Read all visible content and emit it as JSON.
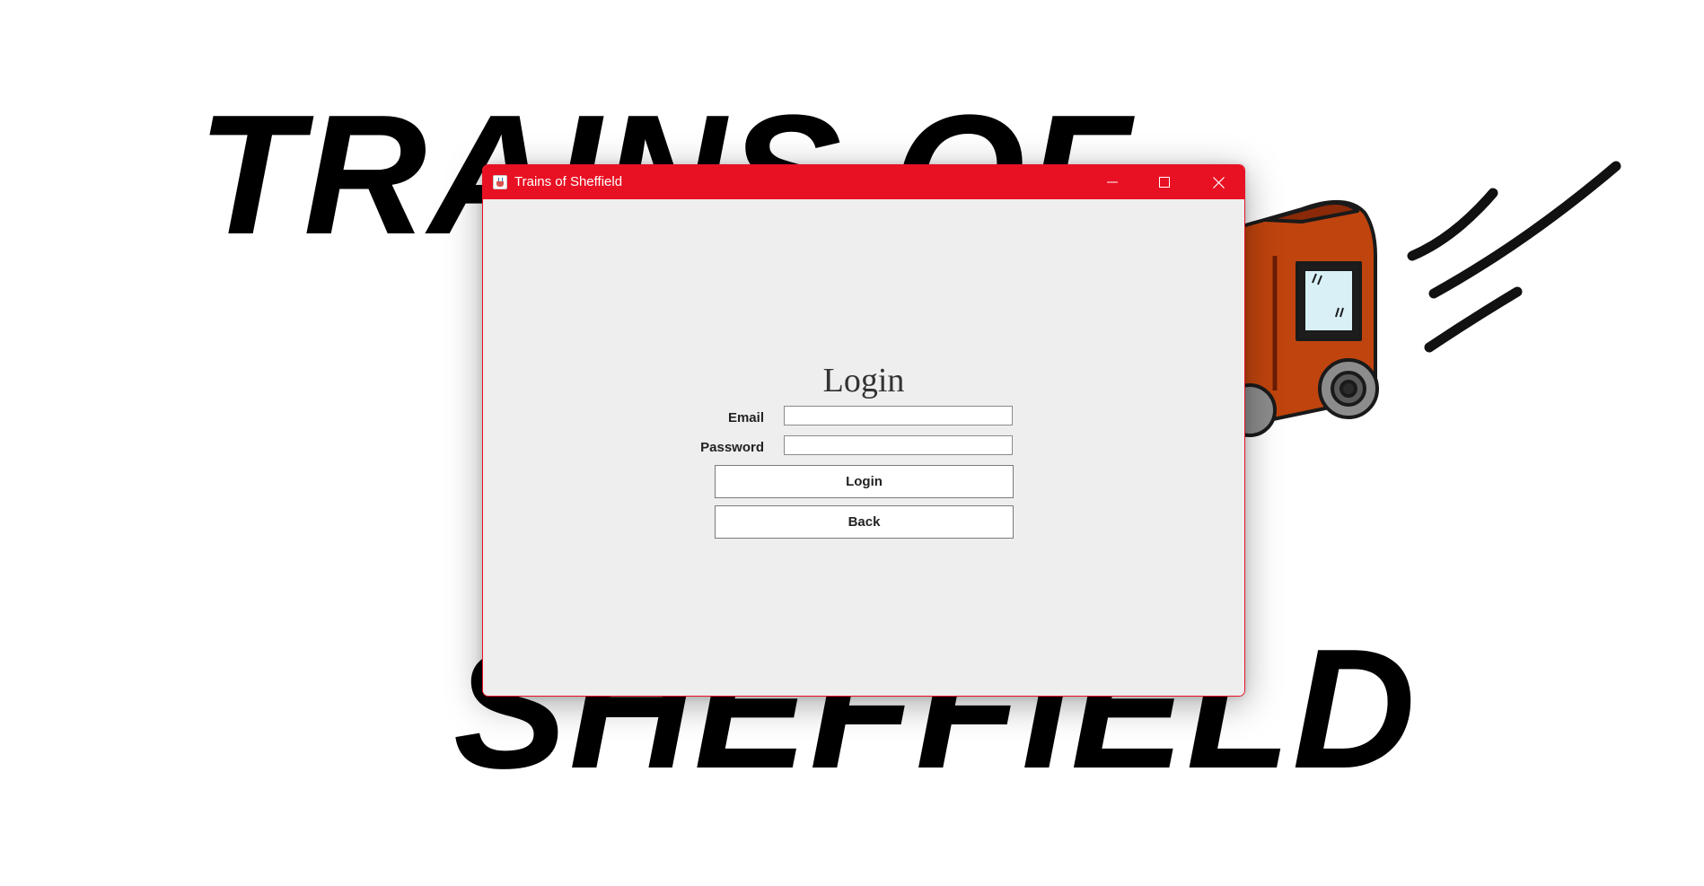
{
  "background": {
    "headline_top": "TRAINS OF",
    "headline_bottom": "SHEFFIELD",
    "illustration": "red-train-carriage-illustration"
  },
  "window": {
    "title": "Trains of Sheffield",
    "app_icon": "java-cup-icon",
    "controls": {
      "minimize_icon": "minimize-icon",
      "maximize_icon": "maximize-icon",
      "close_icon": "close-icon"
    },
    "titlebar_color": "#e81123"
  },
  "login_form": {
    "heading": "Login",
    "email_label": "Email",
    "email_value": "",
    "password_label": "Password",
    "password_value": "",
    "login_button": "Login",
    "back_button": "Back"
  }
}
